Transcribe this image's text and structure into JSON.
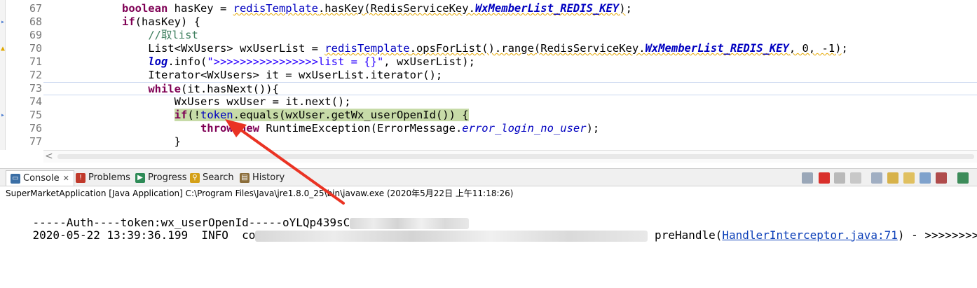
{
  "editor": {
    "lines": [
      {
        "no": "67",
        "marker": "",
        "segments": [
          [
            "txt",
            "            "
          ],
          [
            "kw",
            "boolean"
          ],
          [
            "txt",
            " hasKey = "
          ],
          [
            "fldw",
            "redisTemplate"
          ],
          [
            "txtw",
            ".hasKey(RedisServiceKey."
          ],
          [
            "sfldw",
            "WxMemberList_REDIS_KEY"
          ],
          [
            "txtw",
            ")"
          ],
          [
            "txt",
            ";"
          ]
        ]
      },
      {
        "no": "68",
        "marker": "arrow",
        "segments": [
          [
            "txt",
            "            "
          ],
          [
            "kw",
            "if"
          ],
          [
            "txt",
            "(hasKey) {"
          ]
        ]
      },
      {
        "no": "69",
        "marker": "",
        "segments": [
          [
            "txt",
            "                "
          ],
          [
            "cmt",
            "//取list"
          ]
        ]
      },
      {
        "no": "70",
        "marker": "warn",
        "segments": [
          [
            "txt",
            "                List<WxUsers> wxUserList = "
          ],
          [
            "fldw",
            "redisTemplate"
          ],
          [
            "txtw",
            ".opsForList().range(RedisServiceKey."
          ],
          [
            "sfldw",
            "WxMemberList_REDIS_KEY"
          ],
          [
            "txtw",
            ", 0, -1)"
          ],
          [
            "txt",
            ";"
          ]
        ]
      },
      {
        "no": "71",
        "marker": "",
        "segments": [
          [
            "txt",
            "                "
          ],
          [
            "sfld",
            "log"
          ],
          [
            "txt",
            ".info("
          ],
          [
            "str",
            "\">>>>>>>>>>>>>>>>list = {}\""
          ],
          [
            "txt",
            ", wxUserList);"
          ]
        ]
      },
      {
        "no": "72",
        "marker": "",
        "segments": [
          [
            "txt",
            "                Iterator<WxUsers> it = wxUserList.iterator();"
          ]
        ]
      },
      {
        "no": "73",
        "marker": "",
        "segments": [
          [
            "txt",
            "                "
          ],
          [
            "kw",
            "while"
          ],
          [
            "txt",
            "(it.hasNext()){"
          ]
        ]
      },
      {
        "no": "74",
        "marker": "",
        "segments": [
          [
            "txt",
            "                    WxUsers wxUser = it.next();"
          ]
        ]
      },
      {
        "no": "75",
        "marker": "arrow",
        "segments": [
          [
            "txt",
            "                    "
          ],
          [
            "hlkw",
            "if"
          ],
          [
            "hl",
            "(!"
          ],
          [
            "hlfld",
            "token"
          ],
          [
            "hl",
            ".equals(wxUser.getWx_userOpenId()) {"
          ]
        ]
      },
      {
        "no": "76",
        "marker": "",
        "segments": [
          [
            "txt",
            "                        "
          ],
          [
            "kw",
            "throw"
          ],
          [
            "txt",
            " "
          ],
          [
            "kw",
            "new"
          ],
          [
            "txt",
            " RuntimeException(ErrorMessage."
          ],
          [
            "itf",
            "error_login_no_user"
          ],
          [
            "txt",
            ");"
          ]
        ]
      },
      {
        "no": "77",
        "marker": "",
        "segments": [
          [
            "txt",
            "                    }"
          ]
        ]
      }
    ]
  },
  "console": {
    "tabs": [
      {
        "label": "Console",
        "color": "#3a6ea5",
        "glyph": "▭"
      },
      {
        "label": "Problems",
        "color": "#c0392b",
        "glyph": "!"
      },
      {
        "label": "Progress",
        "color": "#2e8b57",
        "glyph": "▶"
      },
      {
        "label": "Search",
        "color": "#d4a017",
        "glyph": "⚲"
      },
      {
        "label": "History",
        "color": "#8b6d3a",
        "glyph": "▤"
      }
    ],
    "close_glyph": "✕",
    "launch_label": "SuperMarketApplication [Java Application] C:\\Program Files\\Java\\jre1.8.0_25\\bin\\javaw.exe (2020年5月22日 上午11:18:26)",
    "output": {
      "line1_text": "-----Auth----token:wx_userOpenId-----oYLQp439sC",
      "line2_prefix": "2020-05-22 13:39:36.199  INFO  co",
      "line2_method": " preHandle(",
      "line2_link": "HandlerInterceptor.java:71",
      "line2_suffix": ") - >>>>>>>>>"
    }
  },
  "colors": {
    "highlight": "#c7dba8",
    "arrow": "#ea3323",
    "keyword": "#7f0055",
    "field": "#0000c0"
  }
}
